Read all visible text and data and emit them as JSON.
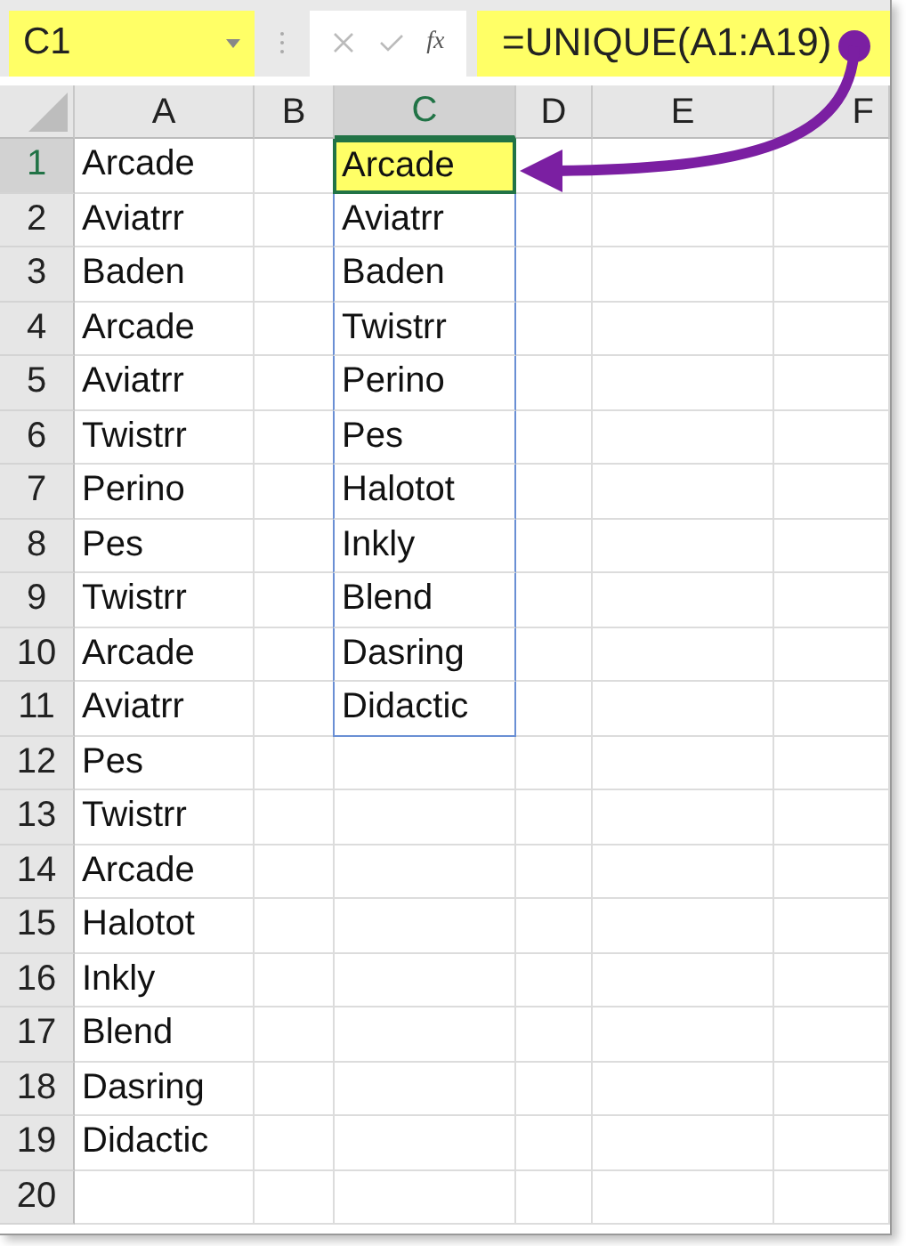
{
  "name_box": {
    "value": "C1"
  },
  "formula_bar": {
    "fx_label": "fx",
    "formula": "=UNIQUE(A1:A19)"
  },
  "columns": [
    {
      "label": "A",
      "selected": false
    },
    {
      "label": "B",
      "selected": false
    },
    {
      "label": "C",
      "selected": true
    },
    {
      "label": "D",
      "selected": false
    },
    {
      "label": "E",
      "selected": false
    },
    {
      "label": "F",
      "selected": false
    }
  ],
  "rows": [
    {
      "number": "1",
      "selected": true,
      "column_a": "Arcade",
      "column_c": "Arcade",
      "c_selected": true
    },
    {
      "number": "2",
      "selected": false,
      "column_a": "Aviatrr",
      "column_c": "Aviatrr",
      "c_selected": false
    },
    {
      "number": "3",
      "selected": false,
      "column_a": "Baden",
      "column_c": "Baden",
      "c_selected": false
    },
    {
      "number": "4",
      "selected": false,
      "column_a": "Arcade",
      "column_c": "Twistrr",
      "c_selected": false
    },
    {
      "number": "5",
      "selected": false,
      "column_a": "Aviatrr",
      "column_c": "Perino",
      "c_selected": false
    },
    {
      "number": "6",
      "selected": false,
      "column_a": "Twistrr",
      "column_c": "Pes",
      "c_selected": false
    },
    {
      "number": "7",
      "selected": false,
      "column_a": "Perino",
      "column_c": "Halotot",
      "c_selected": false
    },
    {
      "number": "8",
      "selected": false,
      "column_a": "Pes",
      "column_c": "Inkly",
      "c_selected": false
    },
    {
      "number": "9",
      "selected": false,
      "column_a": "Twistrr",
      "column_c": "Blend",
      "c_selected": false
    },
    {
      "number": "10",
      "selected": false,
      "column_a": "Arcade",
      "column_c": "Dasring",
      "c_selected": false
    },
    {
      "number": "11",
      "selected": false,
      "column_a": "Aviatrr",
      "column_c": "Didactic",
      "c_selected": false
    },
    {
      "number": "12",
      "selected": false,
      "column_a": "Pes",
      "c_selected": false
    },
    {
      "number": "13",
      "selected": false,
      "column_a": "Twistrr",
      "c_selected": false
    },
    {
      "number": "14",
      "selected": false,
      "column_a": "Arcade",
      "c_selected": false
    },
    {
      "number": "15",
      "selected": false,
      "column_a": "Halotot",
      "c_selected": false
    },
    {
      "number": "16",
      "selected": false,
      "column_a": "Inkly",
      "c_selected": false
    },
    {
      "number": "17",
      "selected": false,
      "column_a": "Blend",
      "c_selected": false
    },
    {
      "number": "18",
      "selected": false,
      "column_a": "Dasring",
      "c_selected": false
    },
    {
      "number": "19",
      "selected": false,
      "column_a": "Didactic",
      "c_selected": false
    },
    {
      "number": "20",
      "selected": false,
      "c_selected": false
    }
  ]
}
